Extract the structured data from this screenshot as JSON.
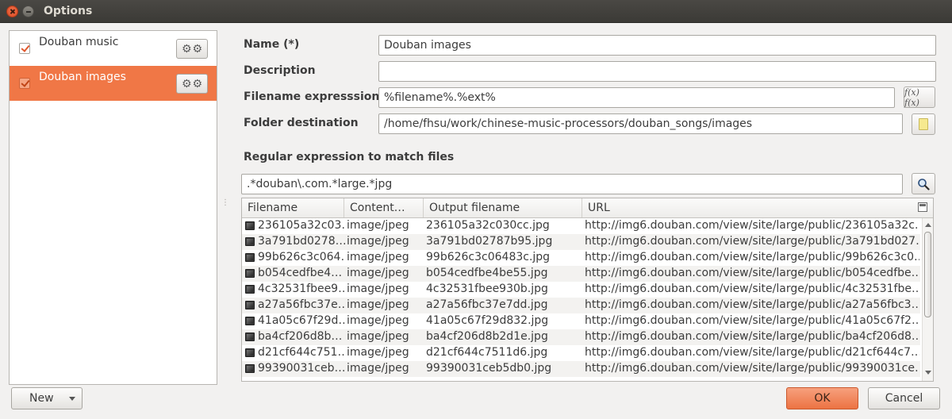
{
  "window": {
    "title": "Options"
  },
  "left_panel": {
    "items": [
      {
        "label": "Douban music",
        "checked": true,
        "selected": false
      },
      {
        "label": "Douban images",
        "checked": true,
        "selected": true
      }
    ]
  },
  "form": {
    "name_label": "Name (*)",
    "name_value": "Douban images",
    "description_label": "Description",
    "description_value": "",
    "filename_label": "Filename expresssion",
    "filename_value": "%filename%.%ext%",
    "folder_label": "Folder destination",
    "folder_value": "/home/fhsu/work/chinese-music-processors/douban_songs/images",
    "regex_label": "Regular expression to match files",
    "regex_value": ".*douban\\.com.*large.*jpg"
  },
  "table": {
    "columns": [
      "Filename",
      "Content…",
      "Output filename",
      "URL"
    ],
    "rows": [
      [
        "236105a32c03…",
        "image/jpeg",
        "236105a32c030cc.jpg",
        "http://img6.douban.com/view/site/large/public/236105a32c…"
      ],
      [
        "3a791bd0278…",
        "image/jpeg",
        "3a791bd02787b95.jpg",
        "http://img6.douban.com/view/site/large/public/3a791bd027…"
      ],
      [
        "99b626c3c064…",
        "image/jpeg",
        "99b626c3c06483c.jpg",
        "http://img6.douban.com/view/site/large/public/99b626c3c0…"
      ],
      [
        "b054cedfbe4…",
        "image/jpeg",
        "b054cedfbe4be55.jpg",
        "http://img6.douban.com/view/site/large/public/b054cedfbe…"
      ],
      [
        "4c32531fbee9…",
        "image/jpeg",
        "4c32531fbee930b.jpg",
        "http://img6.douban.com/view/site/large/public/4c32531fbe…"
      ],
      [
        "a27a56fbc37e…",
        "image/jpeg",
        "a27a56fbc37e7dd.jpg",
        "http://img6.douban.com/view/site/large/public/a27a56fbc3…"
      ],
      [
        "41a05c67f29d…",
        "image/jpeg",
        "41a05c67f29d832.jpg",
        "http://img6.douban.com/view/site/large/public/41a05c67f2…"
      ],
      [
        "ba4cf206d8b…",
        "image/jpeg",
        "ba4cf206d8b2d1e.jpg",
        "http://img6.douban.com/view/site/large/public/ba4cf206d8…"
      ],
      [
        "d21cf644c751…",
        "image/jpeg",
        "d21cf644c7511d6.jpg",
        "http://img6.douban.com/view/site/large/public/d21cf644c7…"
      ],
      [
        "99390031ceb…",
        "image/jpeg",
        "99390031ceb5db0.jpg",
        "http://img6.douban.com/view/site/large/public/99390031ce…"
      ]
    ]
  },
  "buttons": {
    "new_label": "New",
    "ok_label": "OK",
    "cancel_label": "Cancel",
    "formula_icon": "fx-icon",
    "folder_icon": "folder-icon",
    "search_icon": "search-icon"
  },
  "colors": {
    "accent": "#f07746",
    "titlebar": "#3c3b37"
  }
}
